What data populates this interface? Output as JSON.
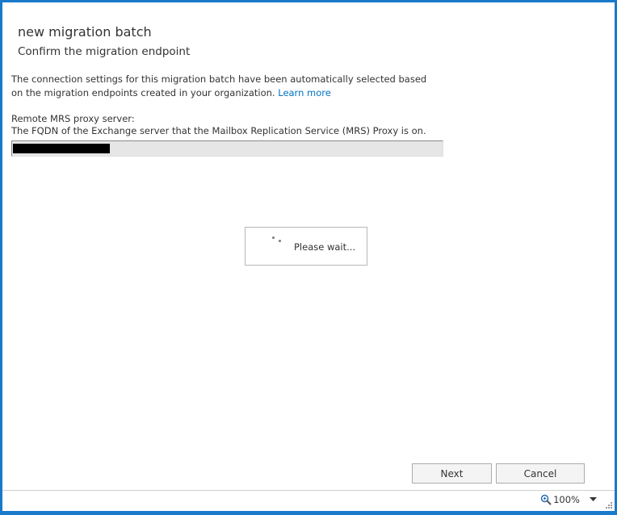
{
  "dialog": {
    "title": "new migration batch",
    "subtitle": "Confirm the migration endpoint",
    "description": "The connection settings for this migration batch have been automatically selected based on the migration endpoints created in your organization.",
    "learn_more": "Learn more"
  },
  "field": {
    "label": "Remote MRS proxy server:",
    "hint": "The FQDN of the Exchange server that the Mailbox Replication Service (MRS) Proxy is on."
  },
  "loading": {
    "text": "Please wait..."
  },
  "buttons": {
    "next": "Next",
    "cancel": "Cancel"
  },
  "statusbar": {
    "zoom": "100%",
    "zoom_icon": "magnifier-icon"
  },
  "colors": {
    "window_border": "#1979ca",
    "link": "#0072c6"
  }
}
